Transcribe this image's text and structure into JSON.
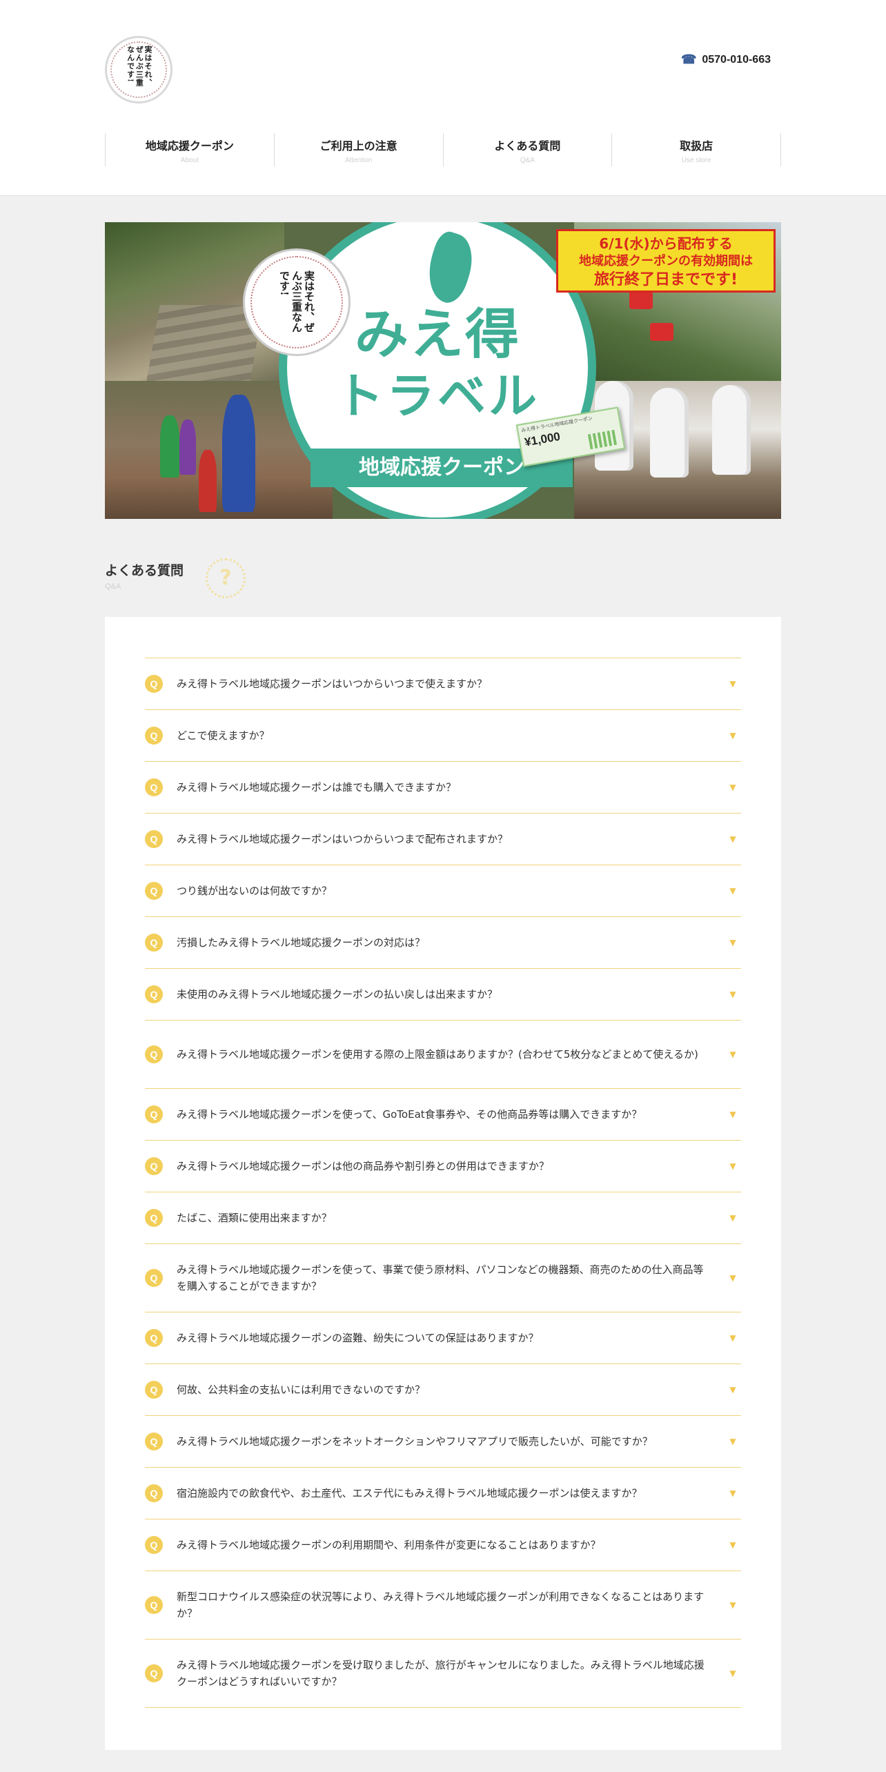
{
  "header": {
    "logo_text": "実はそれ、ぜんぶ三重なんです!",
    "phone_icon": "phone-icon",
    "phone": "0570-010-663"
  },
  "nav": [
    {
      "label": "地域応援クーポン",
      "sub": "About"
    },
    {
      "label": "ご利用上の注意",
      "sub": "Attention"
    },
    {
      "label": "よくある質問",
      "sub": "Q&A"
    },
    {
      "label": "取扱店",
      "sub": "Use store"
    }
  ],
  "banner": {
    "badge_text": "実はそれ、ぜんぶ三重なんです!",
    "title_line1_a": "みえ",
    "title_line1_b": "得",
    "title_line2": "トラベル",
    "ribbon": "地域応援クーポン",
    "notice_l1": "6/1(水)から配布する",
    "notice_l2": "地域応援クーポンの有効期間は",
    "notice_l3": "旅行終了日までです!",
    "coupon_head": "みえ得トラベル地域応援クーポン",
    "coupon_value": "¥1,000",
    "colors": {
      "teal": "#3fae95",
      "yellow": "#f6dc2a",
      "red": "#d8281f"
    }
  },
  "faq": {
    "title": "よくある質問",
    "sub": "Q&A",
    "deco_icon": "question-icon",
    "q_label": "Q",
    "arrow_icon": "triangle-down-icon",
    "accent": "#f3cf5a",
    "items": [
      "みえ得トラベル地域応援クーポンはいつからいつまで使えますか？",
      "どこで使えますか？",
      "みえ得トラベル地域応援クーポンは誰でも購入できますか？",
      "みえ得トラベル地域応援クーポンはいつからいつまで配布されますか？",
      "つり銭が出ないのは何故ですか？",
      "汚損したみえ得トラベル地域応援クーポンの対応は？",
      "未使用のみえ得トラベル地域応援クーポンの払い戻しは出来ますか？",
      "みえ得トラベル地域応援クーポンを使用する際の上限金額はありますか？(合わせて5枚分などまとめて使えるか)",
      "みえ得トラベル地域応援クーポンを使って、GoToEat食事券や、その他商品券等は購入できますか？",
      "みえ得トラベル地域応援クーポンは他の商品券や割引券との併用はできますか？",
      "たばこ、酒類に使用出来ますか？",
      "みえ得トラベル地域応援クーポンを使って、事業で使う原材料、パソコンなどの機器類、商売のための仕入商品等を購入することができますか？",
      "みえ得トラベル地域応援クーポンの盗難、紛失についての保証はありますか？",
      "何故、公共料金の支払いには利用できないのですか？",
      "みえ得トラベル地域応援クーポンをネットオークションやフリマアプリで販売したいが、可能ですか？",
      "宿泊施設内での飲食代や、お土産代、エステ代にもみえ得トラベル地域応援クーポンは使えますか？",
      "みえ得トラベル地域応援クーポンの利用期間や、利用条件が変更になることはありますか？",
      "新型コロナウイルス感染症の状況等により、みえ得トラベル地域応援クーポンが利用できなくなることはありますか？",
      "みえ得トラベル地域応援クーポンを受け取りましたが、旅行がキャンセルになりました。みえ得トラベル地域応援クーポンはどうすればいいですか？"
    ]
  }
}
